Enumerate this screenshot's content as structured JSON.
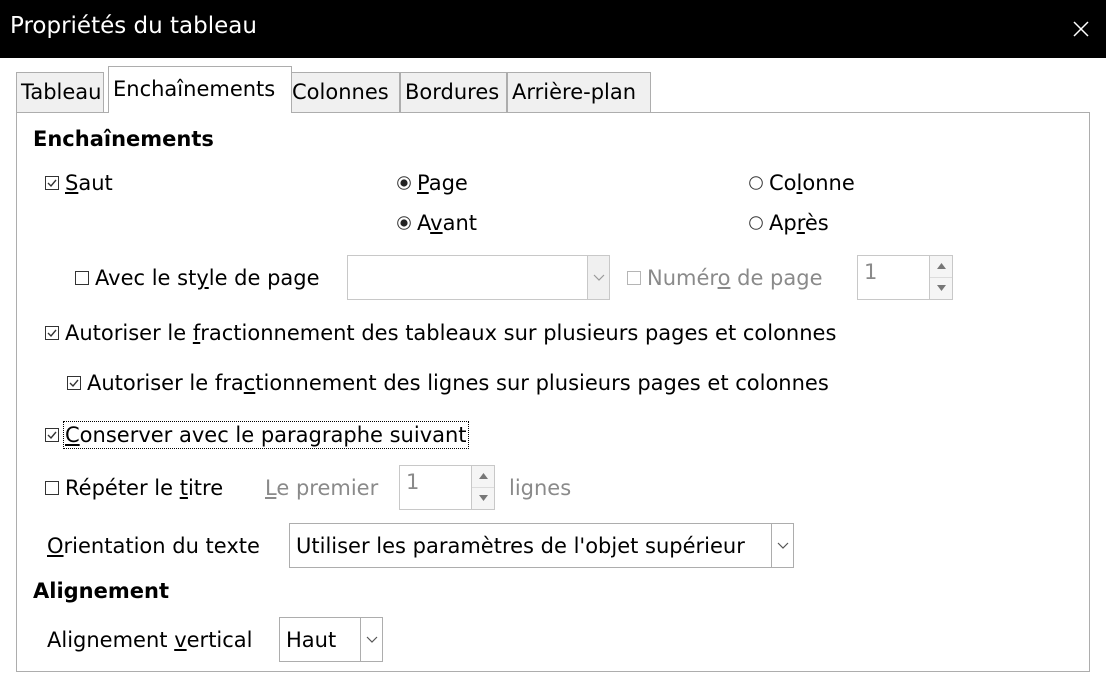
{
  "dialog": {
    "title": "Propriétés du tableau"
  },
  "tabs": [
    {
      "label": "Tableau"
    },
    {
      "label": "Enchaînements",
      "active": true
    },
    {
      "label": "Colonnes"
    },
    {
      "label": "Bordures"
    },
    {
      "label": "Arrière-plan"
    }
  ],
  "section_flow": {
    "heading": "Enchaînements",
    "saut": {
      "label_pre": "",
      "mnemonic": "S",
      "label_post": "aut",
      "checked": true
    },
    "page": {
      "label_pre": "",
      "mnemonic": "P",
      "label_post": "age",
      "selected": true
    },
    "colonne": {
      "label_pre": "Co",
      "mnemonic": "l",
      "label_post": "onne",
      "selected": false
    },
    "avant": {
      "label_pre": "A",
      "mnemonic": "v",
      "label_post": "ant",
      "selected": true
    },
    "apres": {
      "label_pre": "Ap",
      "mnemonic": "r",
      "label_post": "ès",
      "selected": false
    },
    "page_style": {
      "label_pre": "Avec le st",
      "mnemonic": "y",
      "label_post": "le de page",
      "checked": false,
      "value": ""
    },
    "page_number": {
      "label_pre": "Numér",
      "mnemonic": "o",
      "label_post": " de page",
      "checked": false,
      "value": "1"
    },
    "allow_split_tables": {
      "label_pre": "Autoriser le ",
      "mnemonic": "f",
      "label_post": "ractionnement des tableaux sur plusieurs pages et colonnes",
      "checked": true
    },
    "allow_split_rows": {
      "label_pre": "Autoriser le fra",
      "mnemonic": "c",
      "label_post": "tionnement des lignes sur plusieurs pages et colonnes",
      "checked": true
    },
    "keep_with_next": {
      "label_pre": "",
      "mnemonic": "C",
      "label_post": "onserver avec le paragraphe suivant",
      "checked": true
    },
    "repeat_heading": {
      "label_pre": "Répéter le ",
      "mnemonic": "t",
      "label_post": "itre",
      "checked": false
    },
    "first_rows": {
      "label_pre": "",
      "mnemonic": "L",
      "label_post": "e premier",
      "value": "1",
      "suffix": "lignes"
    },
    "text_orientation": {
      "label_pre": "",
      "mnemonic": "O",
      "label_post": "rientation du texte",
      "value": "Utiliser les paramètres de l'objet supérieur"
    }
  },
  "section_align": {
    "heading": "Alignement",
    "vertical": {
      "label_pre": "Alignement ",
      "mnemonic": "v",
      "label_post": "ertical",
      "value": "Haut"
    }
  },
  "icons": {
    "close": "close-icon",
    "checkbox_checked": "checkbox-checked-icon",
    "checkbox_unchecked": "checkbox-unchecked-icon",
    "radio_on": "radio-selected-icon",
    "radio_off": "radio-unselected-icon",
    "chevron": "chevron-down-icon"
  }
}
